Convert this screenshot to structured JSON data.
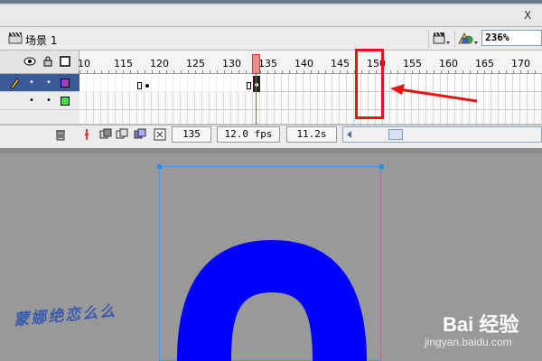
{
  "window": {
    "close_label": "X"
  },
  "scene_bar": {
    "scene_label": "场景 1",
    "zoom_value": "236%"
  },
  "timeline": {
    "ruler_numbers": [
      "10",
      "115",
      "120",
      "125",
      "130",
      "135",
      "140",
      "145",
      "150",
      "155",
      "160",
      "165",
      "170"
    ],
    "current_frame": "135",
    "frame_rate": "12.0 fps",
    "elapsed_time": "11.2s",
    "layers": [
      {
        "selected": true
      },
      {
        "selected": false
      }
    ]
  },
  "colors": {
    "layer1_swatch": "#a040c0",
    "layer2_swatch": "#40e040",
    "shape_fill": "#0000ff",
    "annotation": "#ee1111"
  },
  "watermark": {
    "left_text": "蒙娜绝恋么么",
    "brand": "Bai 经验",
    "url": "jingyan.baidu.com"
  },
  "icons": [
    "scene-clapper-icon",
    "edit-scene-icon",
    "edit-symbol-icon",
    "eye-icon",
    "lock-icon",
    "outline-icon",
    "pencil-icon",
    "trash-icon",
    "onion-skin-icon",
    "scroll-left-icon"
  ]
}
